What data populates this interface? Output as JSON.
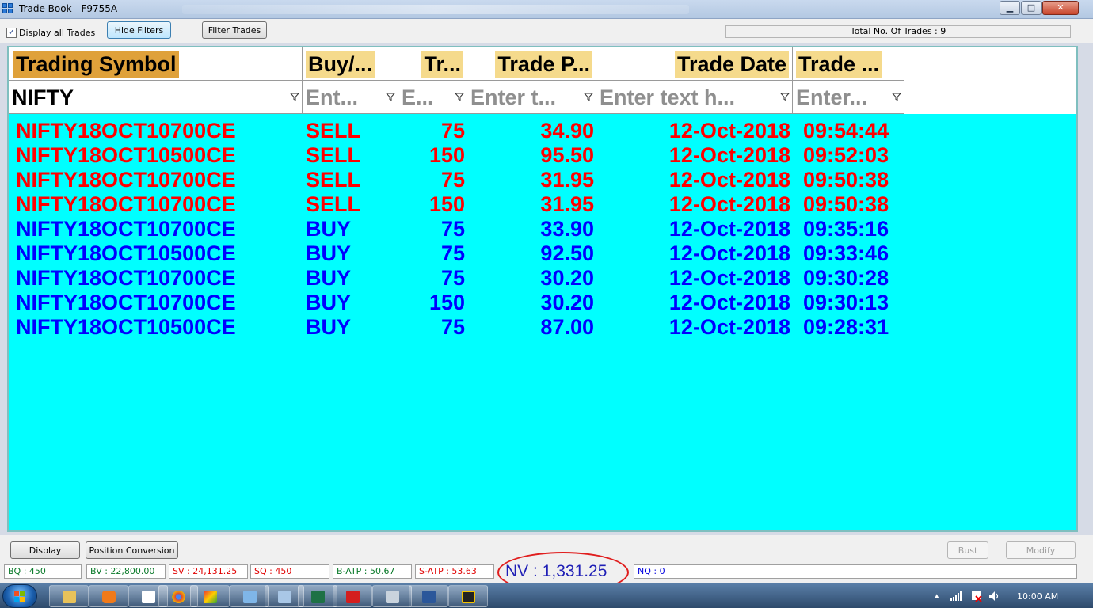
{
  "window": {
    "title": "Trade Book - F9755A",
    "min_label": "▁",
    "max_label": "□",
    "close_label": "✕"
  },
  "toolbar": {
    "display_all_label": "Display all Trades",
    "display_all_checked": true,
    "hide_filters_label": "Hide Filters",
    "filter_trades_label": "Filter Trades",
    "total_trades_text": "Total No. Of Trades : 9"
  },
  "grid": {
    "columns": [
      "Trading Symbol",
      "Buy/...",
      "Tr...",
      "Trade P...",
      "Trade Date",
      "Trade ..."
    ],
    "filters": [
      {
        "value": "NIFTY",
        "placeholder": ""
      },
      {
        "value": "",
        "placeholder": "Ent..."
      },
      {
        "value": "",
        "placeholder": "E..."
      },
      {
        "value": "",
        "placeholder": "Enter t..."
      },
      {
        "value": "",
        "placeholder": "Enter text h..."
      },
      {
        "value": "",
        "placeholder": "Enter..."
      }
    ],
    "rows": [
      {
        "symbol": "NIFTY18OCT10700CE",
        "side": "SELL",
        "qty": "75",
        "price": "34.90",
        "date": "12-Oct-2018",
        "time": "09:54:44"
      },
      {
        "symbol": "NIFTY18OCT10500CE",
        "side": "SELL",
        "qty": "150",
        "price": "95.50",
        "date": "12-Oct-2018",
        "time": "09:52:03"
      },
      {
        "symbol": "NIFTY18OCT10700CE",
        "side": "SELL",
        "qty": "75",
        "price": "31.95",
        "date": "12-Oct-2018",
        "time": "09:50:38"
      },
      {
        "symbol": "NIFTY18OCT10700CE",
        "side": "SELL",
        "qty": "150",
        "price": "31.95",
        "date": "12-Oct-2018",
        "time": "09:50:38"
      },
      {
        "symbol": "NIFTY18OCT10700CE",
        "side": "BUY",
        "qty": "75",
        "price": "33.90",
        "date": "12-Oct-2018",
        "time": "09:35:16"
      },
      {
        "symbol": "NIFTY18OCT10500CE",
        "side": "BUY",
        "qty": "75",
        "price": "92.50",
        "date": "12-Oct-2018",
        "time": "09:33:46"
      },
      {
        "symbol": "NIFTY18OCT10700CE",
        "side": "BUY",
        "qty": "75",
        "price": "30.20",
        "date": "12-Oct-2018",
        "time": "09:30:28"
      },
      {
        "symbol": "NIFTY18OCT10700CE",
        "side": "BUY",
        "qty": "150",
        "price": "30.20",
        "date": "12-Oct-2018",
        "time": "09:30:13"
      },
      {
        "symbol": "NIFTY18OCT10500CE",
        "side": "BUY",
        "qty": "75",
        "price": "87.00",
        "date": "12-Oct-2018",
        "time": "09:28:31"
      }
    ]
  },
  "bottom": {
    "display_label": "Display",
    "position_conversion_label": "Position Conversion",
    "bust_label": "Bust",
    "modify_label": "Modify"
  },
  "status": {
    "bq": "BQ : 450",
    "bv": "BV : 22,800.00",
    "sv": "SV : 24,131.25",
    "sq": "SQ : 450",
    "batp": "B-ATP : 50.67",
    "satp": "S-ATP : 53.63",
    "nv": "NV : 1,331.25",
    "nq": "NQ : 0"
  },
  "taskbar": {
    "clock": "10:00 AM"
  },
  "colors": {
    "sell": "#ff0000",
    "buy": "#0000ff",
    "grid_bg": "#00ffff",
    "header_label": "#f5da8c"
  }
}
